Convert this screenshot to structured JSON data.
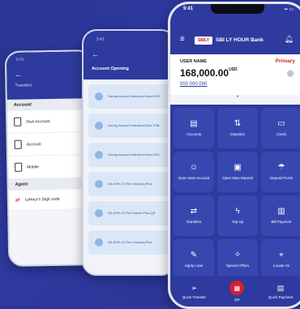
{
  "phone_transfers": {
    "title": "Transfers",
    "time": "9:41",
    "section_account": "Account",
    "items": [
      {
        "label": "Own Account",
        "icon": "document-icon"
      },
      {
        "label": "Account",
        "icon": "document-icon"
      },
      {
        "label": "Mobile",
        "icon": "phone-icon"
      }
    ],
    "section_agent": "Agent",
    "agent_item": "LyHour's Digit code"
  },
  "phone_account_opening": {
    "title": "Account Opening",
    "time": "9:41",
    "items": [
      "Saving Account Individual Non-KHR",
      "Saving Account Individual Non-THB",
      "Saving Account Individual Non-USD",
      "SA-KHR-10 Flex Growing Plus",
      "SA-KHR-10 Flex Future Plus-QR",
      "SA-KHR-10 Flex Growing Plus"
    ]
  },
  "phone_home": {
    "time": "9:41",
    "logo": "SBILY",
    "bank_name": "SBI LY HOUR Bank",
    "user_name_label": "USER NAME",
    "primary_label": "Primary",
    "balance": "168,000.00",
    "currency": "USD",
    "account_number": "000 000 000",
    "menu": [
      {
        "label": "Accounts",
        "icon": "document-icon"
      },
      {
        "label": "Deposits",
        "icon": "deposit-icon"
      },
      {
        "label": "Cards",
        "icon": "card-icon"
      },
      {
        "label": "Open New Account",
        "icon": "user-plus-icon"
      },
      {
        "label": "Open New Deposit",
        "icon": "safe-icon"
      },
      {
        "label": "Deposit PLUS",
        "icon": "umbrella-icon"
      },
      {
        "label": "Transfers",
        "icon": "transfer-icon"
      },
      {
        "label": "Top Up",
        "icon": "bolt-icon"
      },
      {
        "label": "Bill Payment",
        "icon": "bill-icon"
      },
      {
        "label": "Apply Loan",
        "icon": "loan-icon"
      },
      {
        "label": "Special Offers",
        "icon": "offer-icon"
      },
      {
        "label": "Locate Us",
        "icon": "location-icon"
      }
    ],
    "bottom_nav": [
      {
        "label": "Quick Transfer",
        "icon": "send-icon"
      },
      {
        "label": "QR",
        "icon": "qr-icon"
      },
      {
        "label": "Quick Payment",
        "icon": "payment-icon"
      }
    ]
  },
  "colors": {
    "brand": "#2e3a9e",
    "accent": "#d3212f",
    "background": "#2a3596"
  }
}
